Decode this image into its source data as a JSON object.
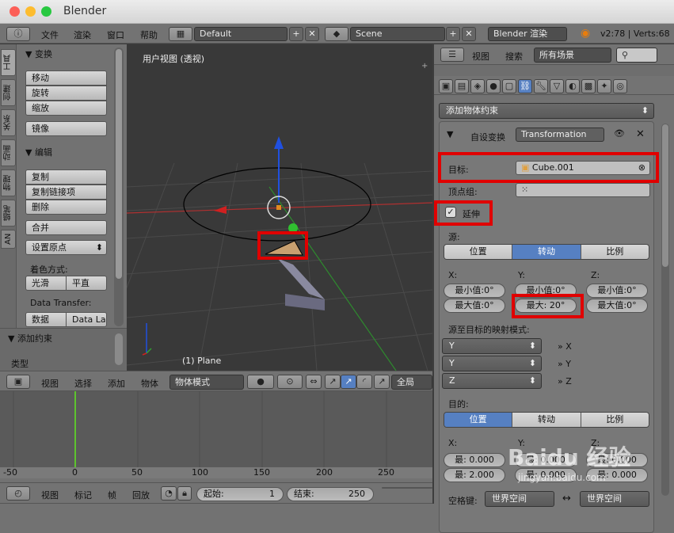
{
  "window": {
    "title": "Blender"
  },
  "topbar": {
    "info_icon": "ⓘ",
    "menu": [
      "文件",
      "渲染",
      "窗口",
      "帮助"
    ],
    "layout": "Default",
    "scene": "Scene",
    "engine": "Blender 渲染",
    "version": "v2:78 | Verts:68"
  },
  "toolshelf": {
    "tabs": [
      "工具",
      "创建",
      "关系",
      "动画",
      "物理",
      "蜡笔",
      "AN"
    ],
    "transform_title": "▼ 变换",
    "transform": [
      "移动",
      "旋转",
      "缩放"
    ],
    "mirror": "镜像",
    "edit_title": "▼ 编辑",
    "edit": [
      "复制",
      "复制链接项",
      "删除"
    ],
    "join": "合并",
    "origin": "设置原点",
    "shading_label": "着色方式:",
    "smooth": "光滑",
    "flat": "平直",
    "data_transfer_label": "Data Transfer:",
    "data": "数据",
    "data_la": "Data La",
    "add_constraint_title": "▼ 添加约束",
    "type_label": "类型"
  },
  "viewport": {
    "title": "用户视图 (透视)",
    "object_label": "(1) Plane"
  },
  "view_header": {
    "items": [
      "视图",
      "选择",
      "添加",
      "物体"
    ],
    "mode": "物体模式",
    "global": "全局"
  },
  "timeline": {
    "ticks": [
      "-50",
      "0",
      "50",
      "100",
      "150",
      "200",
      "250"
    ],
    "menu": [
      "视图",
      "标记",
      "帧",
      "回放"
    ],
    "start_label": "起始:",
    "start": "1",
    "end_label": "结束:",
    "end": "250"
  },
  "outliner": {
    "view": "视图",
    "search": "搜索",
    "scope": "所有场景"
  },
  "properties": {
    "add_constraint": "添加物体约束",
    "constraint_type": "自设变换",
    "constraint_name": "Transformation",
    "target_label": "目标:",
    "target": "Cube.001",
    "vertex_group_label": "顶点组:",
    "extend": "延伸",
    "source_label": "源:",
    "source_tabs": [
      "位置",
      "转动",
      "比例"
    ],
    "source_active": 1,
    "x_label": "X:",
    "y_label": "Y:",
    "z_label": "Z:",
    "x_min": "最小值:0°",
    "x_max": "最大值:0°",
    "y_min": "最小值:0°",
    "y_max": "最大: 20°",
    "z_min": "最小值:0°",
    "z_max": "最大值:0°",
    "mapping_label": "源至目标的映射模式:",
    "map": [
      {
        "src": "Y",
        "dst": "X"
      },
      {
        "src": "Y",
        "dst": "Y"
      },
      {
        "src": "Z",
        "dst": "Z"
      }
    ],
    "dest_label": "目的:",
    "dest_tabs": [
      "位置",
      "转动",
      "比例"
    ],
    "dest_active": 0,
    "dx_label": "X:",
    "dy_label": "Y:",
    "dz_label": "Z:",
    "dx_min": "最: 0.000",
    "dx_max": "最: 2.000",
    "dy_min": "最: 0.000",
    "dy_max": "最: 0.000",
    "dz_min": "最: 0.000",
    "dz_max": "最: 0.000",
    "space_label": "空格键:",
    "owner_space": "世界空间",
    "target_space": "世界空间"
  },
  "watermark": "Baidu 经验",
  "watermark_url": "jingyan.baidu.com",
  "colors": {
    "highlight": "#e00000",
    "active_tab": "#5680c2",
    "green_line": "#5ec42e"
  }
}
